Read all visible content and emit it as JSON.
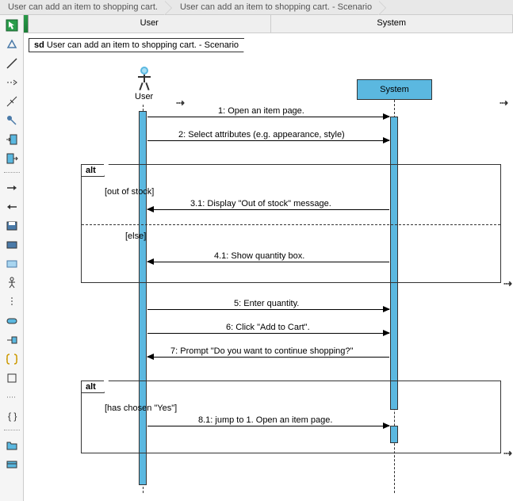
{
  "breadcrumb": {
    "items": [
      "User can add an item to shopping cart.",
      "User can add an item to shopping cart. - Scenario"
    ]
  },
  "header": {
    "col1": "User",
    "col2": "System"
  },
  "frame": {
    "prefix": "sd",
    "title": "User can add an item to shopping cart. - Scenario"
  },
  "actors": {
    "user": "User",
    "system": "System"
  },
  "messages": {
    "m1": "1: Open an item page.",
    "m2": "2: Select attributes (e.g. appearance, style)",
    "m3_1": "3.1: Display \"Out of stock\" message.",
    "m4_1": "4.1: Show quantity box.",
    "m5": "5: Enter quantity.",
    "m6": "6: Click \"Add to Cart\".",
    "m7": "7: Prompt \"Do you want to continue shopping?\"",
    "m8_1": "8.1: jump to 1. Open an item page."
  },
  "alt": {
    "label": "alt",
    "guard1": "[out of stock]",
    "guard2": "[else]",
    "guard3": "[has chosen \"Yes\"]"
  },
  "tools": {
    "t1": "cursor-tool",
    "t2": "triangle-tool",
    "t3": "line-tool",
    "t4": "dash-arrow-tool",
    "t5": "cross-line-tool",
    "t6": "pin-tool",
    "t7": "frame-in-tool",
    "t8": "frame-out-tool",
    "t9": "arrow-right-tool",
    "t10": "arrow-left-tool",
    "t11": "block-save-tool",
    "t12": "block-tool",
    "t13": "rect-tool",
    "t14": "actor-tool",
    "t15": "dash-line-tool",
    "t16": "rounded-rect-tool",
    "t17": "merge-tool",
    "t18": "braces-tool",
    "t19": "square-outline-tool",
    "t20": "dotted-tool",
    "t21": "curly-tool",
    "t22": "folder-tool",
    "t23": "card-tool"
  }
}
